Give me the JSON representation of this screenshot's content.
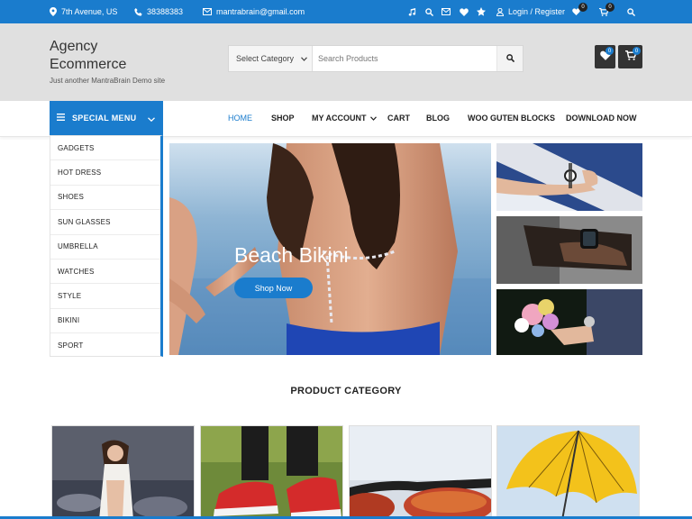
{
  "topbar": {
    "address": "7th Avenue, US",
    "phone": "38388383",
    "email": "mantrabrain@gmail.com",
    "wishlist_count": "0",
    "cart_count": "0",
    "login": "Login / Register"
  },
  "header": {
    "brand": "Agency Ecommerce",
    "tagline": "Just another MantraBrain Demo site",
    "search": {
      "category_selected": "Select Category",
      "placeholder": "Search Products"
    },
    "wishlist_count": "0",
    "cart_count": "0"
  },
  "nav": {
    "special_menu": "SPECIAL MENU",
    "links": [
      "HOME",
      "SHOP",
      "MY ACCOUNT",
      "CART",
      "BLOG",
      "WOO GUTEN BLOCKS",
      "DOWNLOAD NOW"
    ]
  },
  "sidebar": {
    "items": [
      "GADGETS",
      "HOT DRESS",
      "SHOES",
      "SUN GLASSES",
      "UMBRELLA",
      "WATCHES",
      "STYLE",
      "BIKINI",
      "SPORT"
    ]
  },
  "hero": {
    "title": "Beach Bikini",
    "button": "Shop Now"
  },
  "section": {
    "title": "PRODUCT CATEGORY"
  },
  "colors": {
    "accent": "#1a7ccd",
    "header_bg": "#e0e0e0",
    "dark_button": "#333333"
  }
}
